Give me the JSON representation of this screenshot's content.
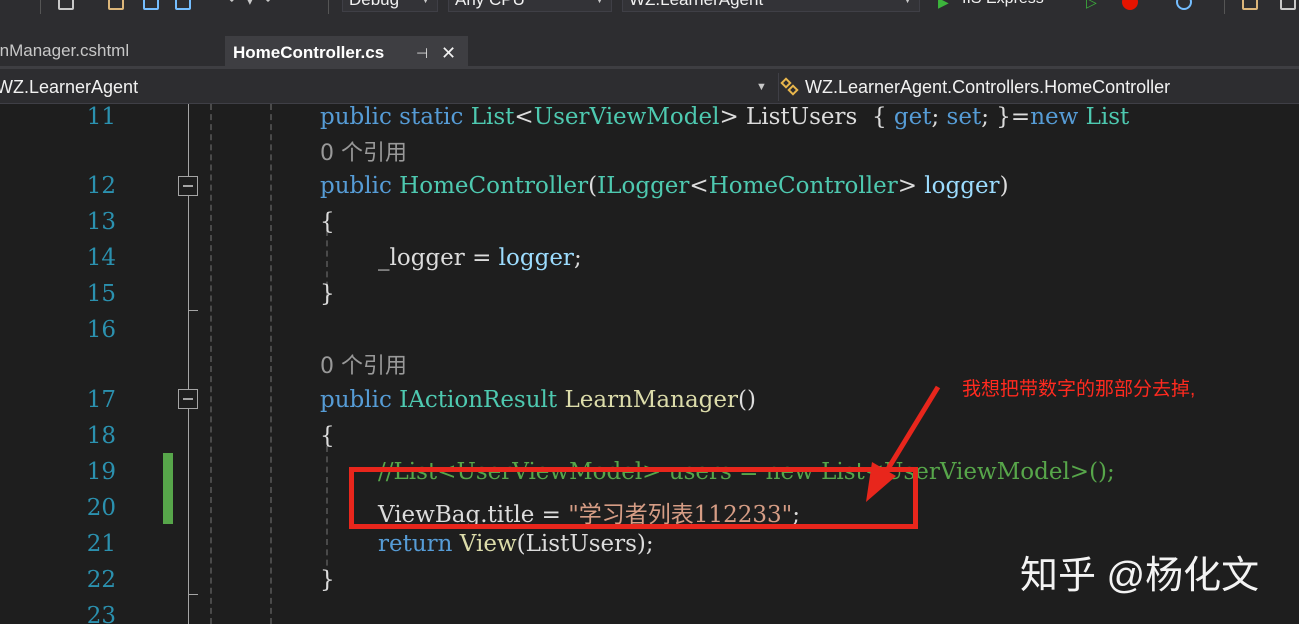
{
  "toolbar": {
    "config": "Debug",
    "platform": "Any CPU",
    "startup_project": "WZ.LearnerAgent",
    "run_target": "IIS Express"
  },
  "tabs": [
    {
      "label": "rnManager.cshtml",
      "active": false
    },
    {
      "label": "HomeController.cs",
      "active": true
    }
  ],
  "tab_pin": "⊣",
  "tab_close": "✕",
  "navbar": {
    "project": "WZ.LearnerAgent",
    "type": "WZ.LearnerAgent.Controllers.HomeController"
  },
  "editor": {
    "line_numbers": [
      "11",
      "12",
      "13",
      "14",
      "15",
      "16",
      "17",
      "18",
      "19",
      "20",
      "21",
      "22",
      "23"
    ],
    "codelens_1": "0 个引用",
    "codelens_2": "0 个引用",
    "lines": {
      "l11": {
        "kw1": "public",
        "kw2": "static",
        "type": "List",
        "lt": "<",
        "type2": "UserViewModel",
        "rest": "> ListUsers  ",
        "brace": "{",
        "get": "get",
        "semi1": ";",
        "set": "set",
        "semi2": ";",
        "close": "}",
        "eq": "=",
        "new": "new",
        "list": "List"
      },
      "l12": {
        "kw": "public",
        "ctor": "HomeController",
        "open": "(",
        "type": "ILogger",
        "lt": "<",
        "type2": "HomeController",
        "gt": ">",
        "param": "logger",
        "close": ")"
      },
      "l13": "{",
      "l14": {
        "field": "_logger",
        "eq": " = ",
        "param": "logger",
        "semi": ";"
      },
      "l15": "}",
      "l17": {
        "kw": "public",
        "type": "IActionResult",
        "name": "LearnManager",
        "parens": "()"
      },
      "l18": "{",
      "l19": "//List<UserViewModel> users = new List<UserViewModel>();",
      "l20": {
        "obj": "ViewBag.title = ",
        "str": "\"学习者列表112233\"",
        "semi": ";"
      },
      "l21": {
        "kw": "return",
        "method": "View",
        "args": "(ListUsers);"
      },
      "l22": "}"
    }
  },
  "annotation": "我想把带数字的那部分去掉,",
  "watermark": "知乎 @杨化文",
  "colors": {
    "annotation": "#e8261c",
    "change_bar": "#57a64a",
    "keyword": "#569cd6",
    "type": "#4ec9b0"
  }
}
